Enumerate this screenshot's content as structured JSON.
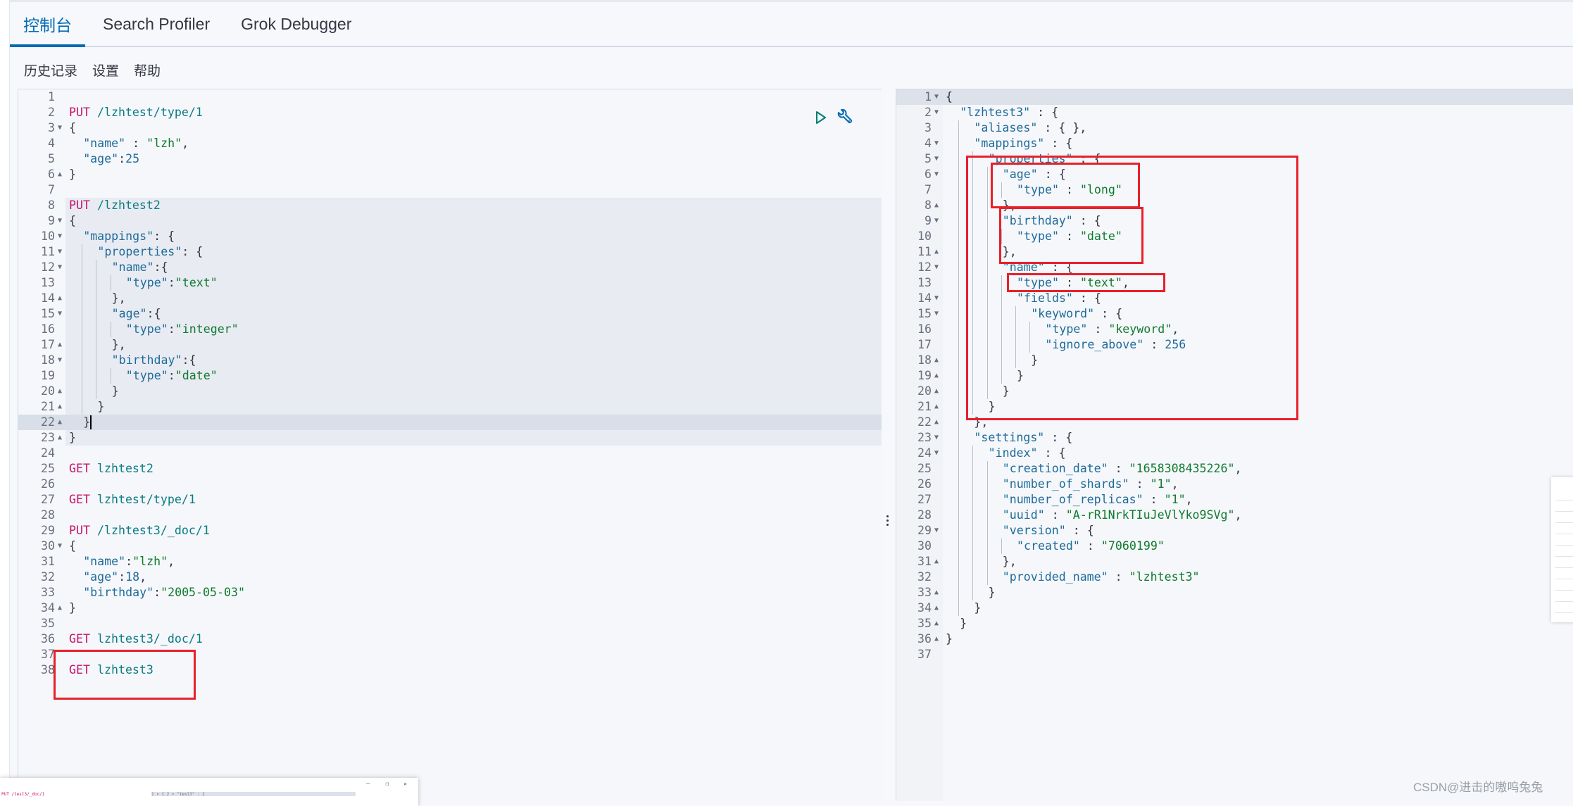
{
  "tabs": [
    {
      "label": "控制台",
      "active": true
    },
    {
      "label": "Search Profiler",
      "active": false
    },
    {
      "label": "Grok Debugger",
      "active": false
    }
  ],
  "subnav": [
    {
      "label": "历史记录"
    },
    {
      "label": "设置"
    },
    {
      "label": "帮助"
    }
  ],
  "request_editor": {
    "active_line": 22,
    "selected_block": [
      8,
      23
    ],
    "action_icons": [
      "play-icon",
      "wrench-icon"
    ],
    "lines": [
      {
        "n": 1,
        "fold": "",
        "indent": 0,
        "tokens": []
      },
      {
        "n": 2,
        "fold": "",
        "indent": 0,
        "tokens": [
          [
            "method",
            "PUT"
          ],
          [
            "punc",
            " "
          ],
          [
            "url",
            "/lzhtest/type/1"
          ]
        ]
      },
      {
        "n": 3,
        "fold": "down",
        "indent": 0,
        "tokens": [
          [
            "punc",
            "{"
          ]
        ]
      },
      {
        "n": 4,
        "fold": "",
        "indent": 1,
        "tokens": [
          [
            "key",
            "\"name\""
          ],
          [
            "punc",
            " : "
          ],
          [
            "str",
            "\"lzh\""
          ],
          [
            "punc",
            ","
          ]
        ]
      },
      {
        "n": 5,
        "fold": "",
        "indent": 1,
        "tokens": [
          [
            "key",
            "\"age\""
          ],
          [
            "punc",
            ":"
          ],
          [
            "num",
            "25"
          ]
        ]
      },
      {
        "n": 6,
        "fold": "up",
        "indent": 0,
        "tokens": [
          [
            "punc",
            "}"
          ]
        ]
      },
      {
        "n": 7,
        "fold": "",
        "indent": 0,
        "tokens": []
      },
      {
        "n": 8,
        "fold": "",
        "indent": 0,
        "tokens": [
          [
            "method",
            "PUT"
          ],
          [
            "punc",
            " "
          ],
          [
            "url",
            "/lzhtest2"
          ]
        ]
      },
      {
        "n": 9,
        "fold": "down",
        "indent": 0,
        "tokens": [
          [
            "punc",
            "{"
          ]
        ]
      },
      {
        "n": 10,
        "fold": "down",
        "indent": 1,
        "tokens": [
          [
            "key",
            "\"mappings\""
          ],
          [
            "punc",
            ": {"
          ]
        ]
      },
      {
        "n": 11,
        "fold": "down",
        "indent": 2,
        "tokens": [
          [
            "key",
            "\"properties\""
          ],
          [
            "punc",
            ": {"
          ]
        ]
      },
      {
        "n": 12,
        "fold": "down",
        "indent": 3,
        "tokens": [
          [
            "key",
            "\"name\""
          ],
          [
            "punc",
            ":{"
          ]
        ]
      },
      {
        "n": 13,
        "fold": "",
        "indent": 4,
        "tokens": [
          [
            "key",
            "\"type\""
          ],
          [
            "punc",
            ":"
          ],
          [
            "str",
            "\"text\""
          ]
        ]
      },
      {
        "n": 14,
        "fold": "up",
        "indent": 3,
        "tokens": [
          [
            "punc",
            "},"
          ]
        ]
      },
      {
        "n": 15,
        "fold": "down",
        "indent": 3,
        "tokens": [
          [
            "key",
            "\"age\""
          ],
          [
            "punc",
            ":{"
          ]
        ]
      },
      {
        "n": 16,
        "fold": "",
        "indent": 4,
        "tokens": [
          [
            "key",
            "\"type\""
          ],
          [
            "punc",
            ":"
          ],
          [
            "str",
            "\"integer\""
          ]
        ]
      },
      {
        "n": 17,
        "fold": "up",
        "indent": 3,
        "tokens": [
          [
            "punc",
            "},"
          ]
        ]
      },
      {
        "n": 18,
        "fold": "down",
        "indent": 3,
        "tokens": [
          [
            "key",
            "\"birthday\""
          ],
          [
            "punc",
            ":{"
          ]
        ]
      },
      {
        "n": 19,
        "fold": "",
        "indent": 4,
        "tokens": [
          [
            "key",
            "\"type\""
          ],
          [
            "punc",
            ":"
          ],
          [
            "str",
            "\"date\""
          ]
        ]
      },
      {
        "n": 20,
        "fold": "up",
        "indent": 3,
        "tokens": [
          [
            "punc",
            "}"
          ]
        ]
      },
      {
        "n": 21,
        "fold": "up",
        "indent": 2,
        "tokens": [
          [
            "punc",
            "}"
          ]
        ]
      },
      {
        "n": 22,
        "fold": "up",
        "indent": 1,
        "tokens": [
          [
            "punc",
            "}"
          ]
        ]
      },
      {
        "n": 23,
        "fold": "up",
        "indent": 0,
        "tokens": [
          [
            "punc",
            "}"
          ]
        ]
      },
      {
        "n": 24,
        "fold": "",
        "indent": 0,
        "tokens": []
      },
      {
        "n": 25,
        "fold": "",
        "indent": 0,
        "tokens": [
          [
            "method",
            "GET"
          ],
          [
            "punc",
            " "
          ],
          [
            "url",
            "lzhtest2"
          ]
        ]
      },
      {
        "n": 26,
        "fold": "",
        "indent": 0,
        "tokens": []
      },
      {
        "n": 27,
        "fold": "",
        "indent": 0,
        "tokens": [
          [
            "method",
            "GET"
          ],
          [
            "punc",
            " "
          ],
          [
            "url",
            "lzhtest/type/1"
          ]
        ]
      },
      {
        "n": 28,
        "fold": "",
        "indent": 0,
        "tokens": []
      },
      {
        "n": 29,
        "fold": "",
        "indent": 0,
        "tokens": [
          [
            "method",
            "PUT"
          ],
          [
            "punc",
            " "
          ],
          [
            "url",
            "/lzhtest3/_doc/1"
          ]
        ]
      },
      {
        "n": 30,
        "fold": "down",
        "indent": 0,
        "tokens": [
          [
            "punc",
            "{"
          ]
        ]
      },
      {
        "n": 31,
        "fold": "",
        "indent": 1,
        "tokens": [
          [
            "key",
            "\"name\""
          ],
          [
            "punc",
            ":"
          ],
          [
            "str",
            "\"lzh\""
          ],
          [
            "punc",
            ","
          ]
        ]
      },
      {
        "n": 32,
        "fold": "",
        "indent": 1,
        "tokens": [
          [
            "key",
            "\"age\""
          ],
          [
            "punc",
            ":"
          ],
          [
            "num",
            "18"
          ],
          [
            "punc",
            ","
          ]
        ]
      },
      {
        "n": 33,
        "fold": "",
        "indent": 1,
        "tokens": [
          [
            "key",
            "\"birthday\""
          ],
          [
            "punc",
            ":"
          ],
          [
            "str",
            "\"2005-05-03\""
          ]
        ]
      },
      {
        "n": 34,
        "fold": "up",
        "indent": 0,
        "tokens": [
          [
            "punc",
            "}"
          ]
        ]
      },
      {
        "n": 35,
        "fold": "",
        "indent": 0,
        "tokens": []
      },
      {
        "n": 36,
        "fold": "",
        "indent": 0,
        "tokens": [
          [
            "method",
            "GET"
          ],
          [
            "punc",
            " "
          ],
          [
            "url",
            "lzhtest3/_doc/1"
          ]
        ]
      },
      {
        "n": 37,
        "fold": "",
        "indent": 0,
        "tokens": []
      },
      {
        "n": 38,
        "fold": "",
        "indent": 0,
        "tokens": [
          [
            "method",
            "GET"
          ],
          [
            "punc",
            " "
          ],
          [
            "url",
            "lzhtest3"
          ]
        ]
      }
    ]
  },
  "response_editor": {
    "lines": [
      {
        "n": 1,
        "fold": "down",
        "indent": 0,
        "tokens": [
          [
            "punc",
            "{"
          ]
        ]
      },
      {
        "n": 2,
        "fold": "down",
        "indent": 1,
        "tokens": [
          [
            "key",
            "\"lzhtest3\""
          ],
          [
            "punc",
            " : {"
          ]
        ]
      },
      {
        "n": 3,
        "fold": "",
        "indent": 2,
        "tokens": [
          [
            "key",
            "\"aliases\""
          ],
          [
            "punc",
            " : { },"
          ]
        ]
      },
      {
        "n": 4,
        "fold": "down",
        "indent": 2,
        "tokens": [
          [
            "key",
            "\"mappings\""
          ],
          [
            "punc",
            " : {"
          ]
        ]
      },
      {
        "n": 5,
        "fold": "down",
        "indent": 3,
        "tokens": [
          [
            "key",
            "\"properties\""
          ],
          [
            "punc",
            " : {"
          ]
        ]
      },
      {
        "n": 6,
        "fold": "down",
        "indent": 4,
        "tokens": [
          [
            "key",
            "\"age\""
          ],
          [
            "punc",
            " : {"
          ]
        ]
      },
      {
        "n": 7,
        "fold": "",
        "indent": 5,
        "tokens": [
          [
            "key",
            "\"type\""
          ],
          [
            "punc",
            " : "
          ],
          [
            "str",
            "\"long\""
          ]
        ]
      },
      {
        "n": 8,
        "fold": "up",
        "indent": 4,
        "tokens": [
          [
            "punc",
            "},"
          ]
        ]
      },
      {
        "n": 9,
        "fold": "down",
        "indent": 4,
        "tokens": [
          [
            "key",
            "\"birthday\""
          ],
          [
            "punc",
            " : {"
          ]
        ]
      },
      {
        "n": 10,
        "fold": "",
        "indent": 5,
        "tokens": [
          [
            "key",
            "\"type\""
          ],
          [
            "punc",
            " : "
          ],
          [
            "str",
            "\"date\""
          ]
        ]
      },
      {
        "n": 11,
        "fold": "up",
        "indent": 4,
        "tokens": [
          [
            "punc",
            "},"
          ]
        ]
      },
      {
        "n": 12,
        "fold": "down",
        "indent": 4,
        "tokens": [
          [
            "key",
            "\"name\""
          ],
          [
            "punc",
            " : {"
          ]
        ]
      },
      {
        "n": 13,
        "fold": "",
        "indent": 5,
        "tokens": [
          [
            "key",
            "\"type\""
          ],
          [
            "punc",
            " : "
          ],
          [
            "str",
            "\"text\""
          ],
          [
            "punc",
            ","
          ]
        ]
      },
      {
        "n": 14,
        "fold": "down",
        "indent": 5,
        "tokens": [
          [
            "key",
            "\"fields\""
          ],
          [
            "punc",
            " : {"
          ]
        ]
      },
      {
        "n": 15,
        "fold": "down",
        "indent": 6,
        "tokens": [
          [
            "key",
            "\"keyword\""
          ],
          [
            "punc",
            " : {"
          ]
        ]
      },
      {
        "n": 16,
        "fold": "",
        "indent": 7,
        "tokens": [
          [
            "key",
            "\"type\""
          ],
          [
            "punc",
            " : "
          ],
          [
            "str",
            "\"keyword\""
          ],
          [
            "punc",
            ","
          ]
        ]
      },
      {
        "n": 17,
        "fold": "",
        "indent": 7,
        "tokens": [
          [
            "key",
            "\"ignore_above\""
          ],
          [
            "punc",
            " : "
          ],
          [
            "num",
            "256"
          ]
        ]
      },
      {
        "n": 18,
        "fold": "up",
        "indent": 6,
        "tokens": [
          [
            "punc",
            "}"
          ]
        ]
      },
      {
        "n": 19,
        "fold": "up",
        "indent": 5,
        "tokens": [
          [
            "punc",
            "}"
          ]
        ]
      },
      {
        "n": 20,
        "fold": "up",
        "indent": 4,
        "tokens": [
          [
            "punc",
            "}"
          ]
        ]
      },
      {
        "n": 21,
        "fold": "up",
        "indent": 3,
        "tokens": [
          [
            "punc",
            "}"
          ]
        ]
      },
      {
        "n": 22,
        "fold": "up",
        "indent": 2,
        "tokens": [
          [
            "punc",
            "},"
          ]
        ]
      },
      {
        "n": 23,
        "fold": "down",
        "indent": 2,
        "tokens": [
          [
            "key",
            "\"settings\""
          ],
          [
            "punc",
            " : {"
          ]
        ]
      },
      {
        "n": 24,
        "fold": "down",
        "indent": 3,
        "tokens": [
          [
            "key",
            "\"index\""
          ],
          [
            "punc",
            " : {"
          ]
        ]
      },
      {
        "n": 25,
        "fold": "",
        "indent": 4,
        "tokens": [
          [
            "key",
            "\"creation_date\""
          ],
          [
            "punc",
            " : "
          ],
          [
            "str",
            "\"1658308435226\""
          ],
          [
            "punc",
            ","
          ]
        ]
      },
      {
        "n": 26,
        "fold": "",
        "indent": 4,
        "tokens": [
          [
            "key",
            "\"number_of_shards\""
          ],
          [
            "punc",
            " : "
          ],
          [
            "str",
            "\"1\""
          ],
          [
            "punc",
            ","
          ]
        ]
      },
      {
        "n": 27,
        "fold": "",
        "indent": 4,
        "tokens": [
          [
            "key",
            "\"number_of_replicas\""
          ],
          [
            "punc",
            " : "
          ],
          [
            "str",
            "\"1\""
          ],
          [
            "punc",
            ","
          ]
        ]
      },
      {
        "n": 28,
        "fold": "",
        "indent": 4,
        "tokens": [
          [
            "key",
            "\"uuid\""
          ],
          [
            "punc",
            " : "
          ],
          [
            "str",
            "\"A-rR1NrkTIuJeVlYko9SVg\""
          ],
          [
            "punc",
            ","
          ]
        ]
      },
      {
        "n": 29,
        "fold": "down",
        "indent": 4,
        "tokens": [
          [
            "key",
            "\"version\""
          ],
          [
            "punc",
            " : {"
          ]
        ]
      },
      {
        "n": 30,
        "fold": "",
        "indent": 5,
        "tokens": [
          [
            "key",
            "\"created\""
          ],
          [
            "punc",
            " : "
          ],
          [
            "str",
            "\"7060199\""
          ]
        ]
      },
      {
        "n": 31,
        "fold": "up",
        "indent": 4,
        "tokens": [
          [
            "punc",
            "},"
          ]
        ]
      },
      {
        "n": 32,
        "fold": "",
        "indent": 4,
        "tokens": [
          [
            "key",
            "\"provided_name\""
          ],
          [
            "punc",
            " : "
          ],
          [
            "str",
            "\"lzhtest3\""
          ]
        ]
      },
      {
        "n": 33,
        "fold": "up",
        "indent": 3,
        "tokens": [
          [
            "punc",
            "}"
          ]
        ]
      },
      {
        "n": 34,
        "fold": "up",
        "indent": 2,
        "tokens": [
          [
            "punc",
            "}"
          ]
        ]
      },
      {
        "n": 35,
        "fold": "up",
        "indent": 1,
        "tokens": [
          [
            "punc",
            "}"
          ]
        ]
      },
      {
        "n": 36,
        "fold": "up",
        "indent": 0,
        "tokens": [
          [
            "punc",
            "}"
          ]
        ]
      },
      {
        "n": 37,
        "fold": "",
        "indent": 0,
        "tokens": []
      }
    ]
  },
  "thumbnail": {
    "left_text": "PUT /test3/_doc/1",
    "right_text": "1 ▾ {   2 ▾  \"test3\" : {",
    "window_controls": "－ ❐ ✕"
  },
  "watermark": "CSDN@进击的嗷呜兔兔",
  "colors": {
    "accent": "#006bb4",
    "method": "#c8116a",
    "url": "#0a7b83",
    "key": "#1f6b9a",
    "string": "#117a2f",
    "annotation": "#e8202a"
  }
}
